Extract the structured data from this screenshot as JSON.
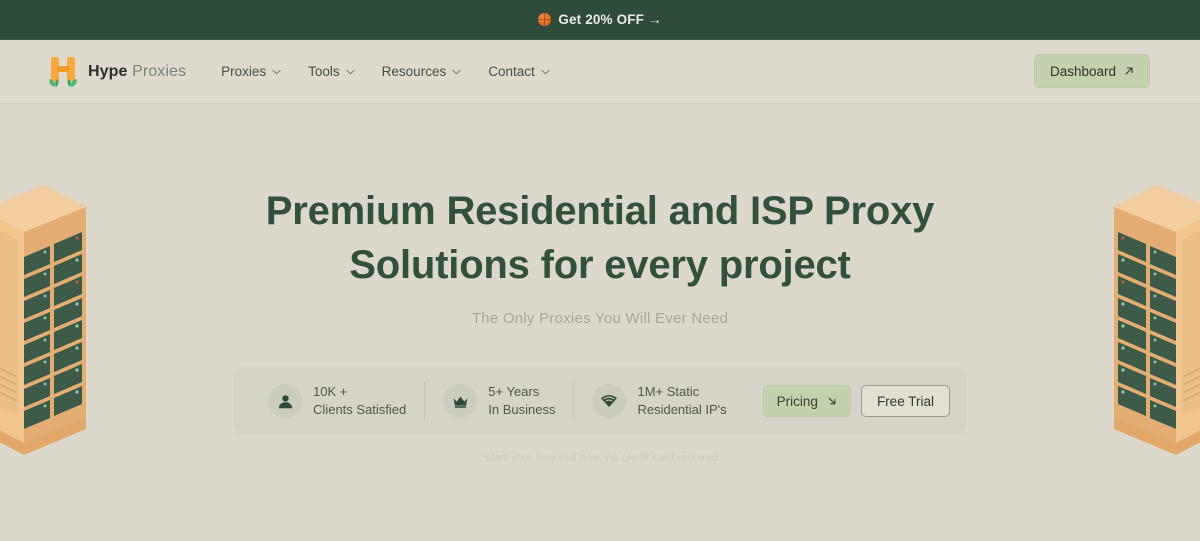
{
  "announcement": {
    "icon": "basketball-icon",
    "text": "Get 20% OFF →"
  },
  "header": {
    "logo_icon": "hype-proxies-logo-icon",
    "brand_strong": "Hype",
    "brand_light": "Proxies",
    "nav": [
      {
        "label": "Proxies",
        "icon": "chevron-down-icon"
      },
      {
        "label": "Tools",
        "icon": "chevron-down-icon"
      },
      {
        "label": "Resources",
        "icon": "chevron-down-icon"
      },
      {
        "label": "Contact",
        "icon": "chevron-down-icon"
      }
    ],
    "dashboard": {
      "label": "Dashboard",
      "icon": "arrow-up-right-icon"
    }
  },
  "hero": {
    "headline_line1": "Premium Residential and ISP Proxy",
    "headline_line2": "Solutions for every project",
    "subheadline": "The Only Proxies You Will Ever Need",
    "footnote": "*start your free trial now, no credit card required"
  },
  "stats": [
    {
      "icon": "user-icon",
      "line1": "10K +",
      "line2": "Clients Satisfied"
    },
    {
      "icon": "crown-icon",
      "line1": "5+ Years",
      "line2": "In Business"
    },
    {
      "icon": "wifi-icon",
      "line1": "1M+ Static",
      "line2": "Residential IP's"
    }
  ],
  "cta": {
    "pricing_label": "Pricing",
    "pricing_icon": "arrow-down-right-icon",
    "trial_label": "Free Trial"
  },
  "illustrations": {
    "left_rack": "server-rack-illustration",
    "right_rack": "server-rack-illustration"
  },
  "colors": {
    "page_bg": "#dcd8cb",
    "banner_bg": "#2f4b3a",
    "header_bg": "#dedacd",
    "heading_green": "#31503e",
    "accent_green": "#c3d1b0",
    "rack_tan": "#edbd7c",
    "rack_slot": "#3a4f3f"
  }
}
